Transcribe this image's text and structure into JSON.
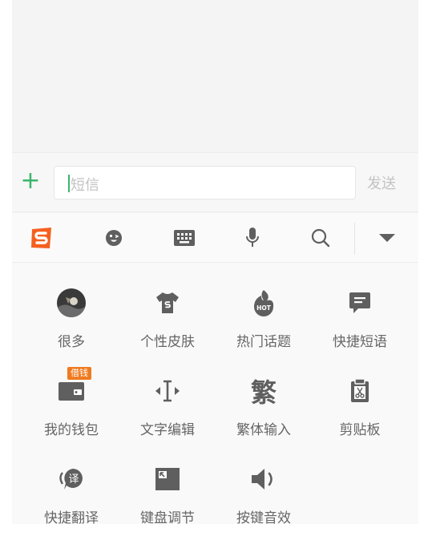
{
  "compose": {
    "placeholder": "短信",
    "send_label": "发送"
  },
  "toolbar": {
    "icons": [
      "sogou-logo-icon",
      "emoji-icon",
      "keyboard-icon",
      "microphone-icon",
      "search-icon",
      "collapse-icon"
    ]
  },
  "panel": {
    "items": [
      {
        "label": "很多",
        "icon": "avatar-icon"
      },
      {
        "label": "个性皮肤",
        "icon": "tshirt-icon"
      },
      {
        "label": "热门话题",
        "icon": "hot-icon"
      },
      {
        "label": "快捷短语",
        "icon": "message-icon"
      },
      {
        "label": "我的钱包",
        "icon": "wallet-icon"
      },
      {
        "label": "文字编辑",
        "icon": "cursor-edit-icon"
      },
      {
        "label": "繁体输入",
        "icon": "traditional-icon"
      },
      {
        "label": "剪贴板",
        "icon": "clipboard-icon"
      },
      {
        "label": "快捷翻译",
        "icon": "translate-icon"
      },
      {
        "label": "键盘调节",
        "icon": "keyboard-adjust-icon"
      },
      {
        "label": "按键音效",
        "icon": "speaker-icon"
      }
    ],
    "wallet_badge": "借钱",
    "traditional_glyph": "繁",
    "translate_glyph": "译"
  },
  "colors": {
    "accent_green": "#3bb56b",
    "brand_orange": "#f5601f",
    "icon_gray": "#5f5f5f",
    "label_gray": "#666666",
    "badge_orange": "#ef7a1f"
  }
}
